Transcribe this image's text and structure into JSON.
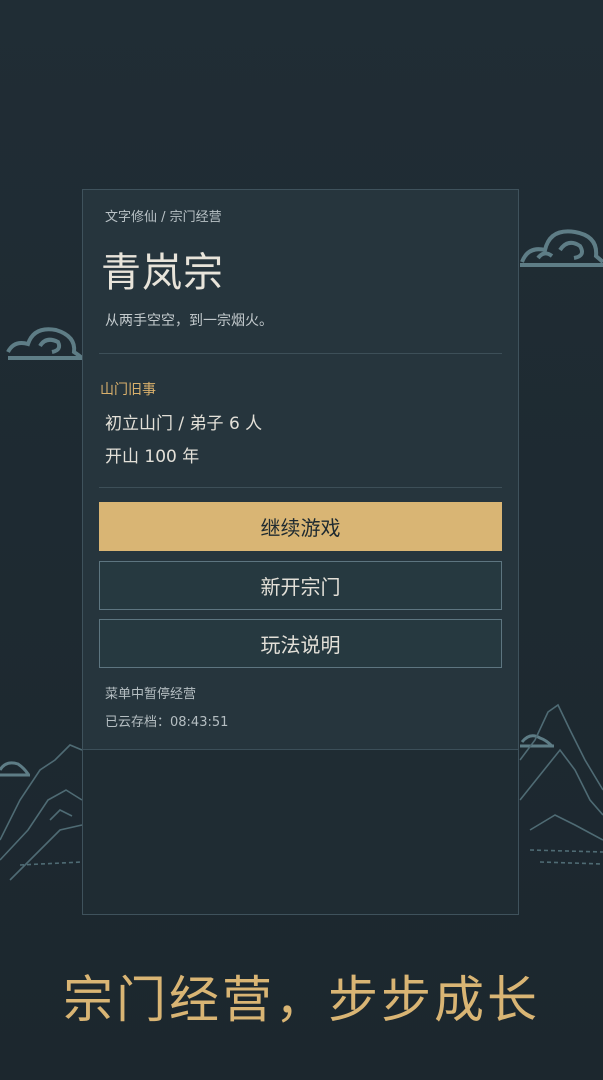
{
  "header": {
    "breadcrumb": "文字修仙 / 宗门经营",
    "sect_name": "青岚宗",
    "motto": "从两手空空，到一宗烟火。"
  },
  "history": {
    "title": "山门旧事",
    "line1": "初立山门 / 弟子 6 人",
    "line2": "开山 100 年"
  },
  "buttons": {
    "continue_label": "继续游戏",
    "new_sect_label": "新开宗门",
    "guide_label": "玩法说明"
  },
  "notes": {
    "pause_hint": "菜单中暂停经营",
    "cloud_save": "已云存档：08:43:51"
  },
  "tagline": "宗门经营，步步成长",
  "colors": {
    "accent": "#d9b574",
    "background": "#1f2b33",
    "panel": "#26353d",
    "panel_border": "#3f525c"
  }
}
